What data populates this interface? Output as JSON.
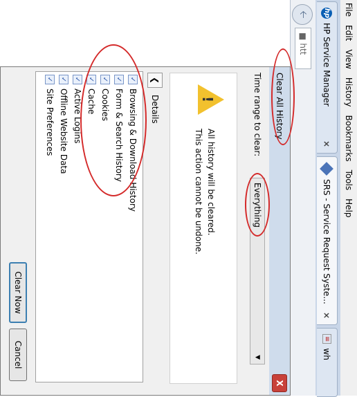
{
  "menubar": {
    "items": [
      "File",
      "Edit",
      "View",
      "History",
      "Bookmarks",
      "Tools",
      "Help"
    ]
  },
  "tabs": [
    {
      "title": "HP Service Manager",
      "icon": "hp-icon",
      "close": "×"
    },
    {
      "title": "SRS - Service Request Syste...",
      "icon": "srs-icon",
      "close": "×"
    },
    {
      "title": "wh",
      "icon": "site-icon"
    }
  ],
  "navbar": {
    "back_icon": "back-arrow-icon",
    "url_text": "htt"
  },
  "dialog": {
    "title": "Clear All History",
    "close_label": "X",
    "time_range_label": "Time range to clear:",
    "time_range_value": "Everything",
    "warning_line1": "All history will be cleared.",
    "warning_line2": "This action cannot be undone.",
    "details_label": "Details",
    "items": [
      {
        "label": "Browsing & Download History",
        "checked": true
      },
      {
        "label": "Form & Search History",
        "checked": true
      },
      {
        "label": "Cookies",
        "checked": true
      },
      {
        "label": "Cache",
        "checked": true
      },
      {
        "label": "Active Logins",
        "checked": true
      },
      {
        "label": "Offline Website Data",
        "checked": true
      },
      {
        "label": "Site Preferences",
        "checked": true
      }
    ],
    "clear_now_label": "Clear Now",
    "cancel_label": "Cancel"
  },
  "colors": {
    "annotation": "#d42a2a",
    "titlebar": "#cfdcec",
    "close_button": "#c8413a",
    "warning": "#f2c12e"
  }
}
